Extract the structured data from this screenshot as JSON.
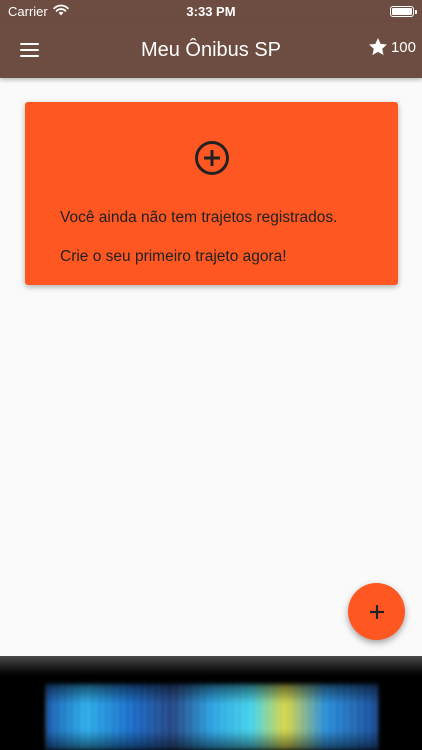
{
  "status_bar": {
    "carrier": "Carrier",
    "time": "3:33 PM"
  },
  "app_bar": {
    "menu_icon": "menu-icon",
    "title": "Meu Ônibus SP",
    "points_icon": "star-icon",
    "points_value": "100",
    "color": "#6d4c41"
  },
  "empty_state": {
    "icon": "add-circle-outline-icon",
    "line_1": "Você ainda não tem trajetos registrados.",
    "line_2": "Crie o seu primeiro trajeto agora!",
    "color": "#ff5722"
  },
  "fab": {
    "icon": "add-icon",
    "color": "#ff5722"
  },
  "ad_banner": {
    "content": "blurred-ad-image"
  }
}
